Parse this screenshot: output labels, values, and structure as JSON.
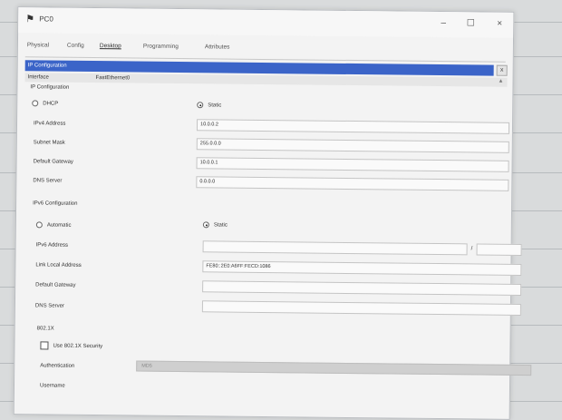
{
  "window": {
    "title": "PC0",
    "minimize": "–",
    "maximize": "☐",
    "close": "×"
  },
  "tabs": [
    "Physical",
    "Config",
    "Desktop",
    "Programming",
    "Attributes"
  ],
  "panel": {
    "header": "IP Configuration",
    "close": "x"
  },
  "interface": {
    "label": "Interface",
    "value": "FastEthernet0"
  },
  "ipv4": {
    "section": "IP Configuration",
    "dhcp": "DHCP",
    "static": "Static",
    "address_label": "IPv4 Address",
    "address": "10.0.0.2",
    "mask_label": "Subnet Mask",
    "mask": "255.0.0.0",
    "gateway_label": "Default Gateway",
    "gateway": "10.0.0.1",
    "dns_label": "DNS Server",
    "dns": "0.0.0.0"
  },
  "ipv6": {
    "section": "IPv6 Configuration",
    "automatic": "Automatic",
    "static": "Static",
    "address_label": "IPv6 Address",
    "address": "",
    "prefix_sep": "/",
    "prefix": "",
    "link_local_label": "Link Local Address",
    "link_local": "FE80::2E0:A6FF:FECD:1086",
    "gateway_label": "Default Gateway",
    "gateway": "",
    "dns_label": "DNS Server",
    "dns": ""
  },
  "dot1x": {
    "section": "802.1X",
    "use_label": "Use 802.1X Security",
    "auth_label": "Authentication",
    "auth_value": "MD5",
    "username_label": "Username"
  }
}
